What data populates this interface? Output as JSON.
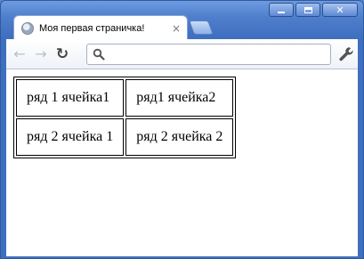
{
  "window": {
    "controls": {
      "minimize": "minimize",
      "maximize": "maximize",
      "close": "✕"
    }
  },
  "tab": {
    "title": "Моя первая страничка!",
    "close": "×"
  },
  "toolbar": {
    "back": "←",
    "forward": "→",
    "reload": "↻",
    "omnibox_value": ""
  },
  "table": {
    "rows": [
      [
        "ряд 1 ячейка1",
        "ряд1 ячейка2"
      ],
      [
        "ряд 2 ячейка 1",
        "ряд 2 ячейка 2"
      ]
    ]
  }
}
